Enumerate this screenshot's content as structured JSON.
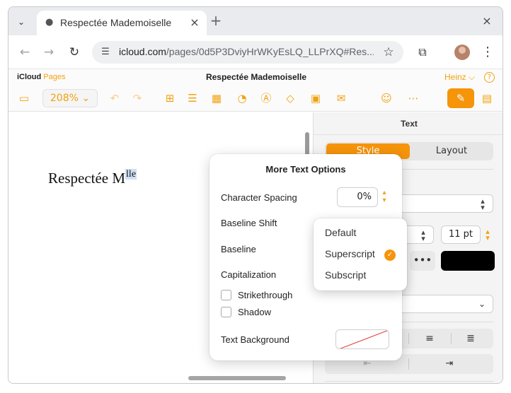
{
  "browser": {
    "tab_title": "Respectée Mademoiselle",
    "url_host": "icloud.com",
    "url_path": "/pages/0d5P3DviyHrWKyEsLQ_LLPrXQ#Res...",
    "icons": [
      "chevron-down-icon",
      "apple-icon",
      "close-icon",
      "plus-icon",
      "back-icon",
      "forward-icon",
      "reload-icon",
      "site-settings-icon",
      "star-icon",
      "extensions-icon",
      "kebab-icon"
    ]
  },
  "app": {
    "brand_icloud": "iCloud",
    "brand_pages": "Pages",
    "doc_title": "Respectée Mademoiselle",
    "user": "Heinz",
    "zoom": "208%",
    "accent_color": "#f6940a"
  },
  "document": {
    "text_main": "Respectée M",
    "text_superscript": "lle"
  },
  "sidebar": {
    "header": "Text",
    "tab_style": "Style",
    "tab_layout": "Layout",
    "font_size": "11 pt",
    "more_label": "•••",
    "text_color": "#000000"
  },
  "popover": {
    "title": "More Text Options",
    "character_spacing_label": "Character Spacing",
    "character_spacing_value": "0%",
    "baseline_shift_label": "Baseline Shift",
    "baseline_label": "Baseline",
    "capitalization_label": "Capitalization",
    "strikethrough_label": "Strikethrough",
    "shadow_label": "Shadow",
    "text_background_label": "Text Background"
  },
  "baseline_menu": {
    "items": [
      "Default",
      "Superscript",
      "Subscript"
    ],
    "selected": "Superscript"
  }
}
